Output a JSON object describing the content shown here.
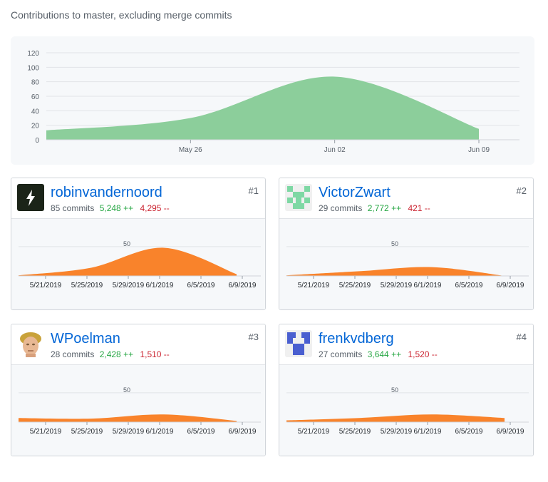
{
  "subtitle": "Contributions to master, excluding merge commits",
  "colors": {
    "main_area": "#8cce9b",
    "user_area": "#f9832b",
    "link": "#0366d6",
    "additions": "#28a745",
    "deletions": "#cb2431"
  },
  "chart_data": [
    {
      "type": "area",
      "title": "",
      "xlabel": "",
      "ylabel": "",
      "ylim": [
        0,
        120
      ],
      "y_ticks": [
        "0",
        "20",
        "40",
        "60",
        "80",
        "100",
        "120"
      ],
      "x_tick_labels": [
        "May 26",
        "Jun 02",
        "Jun 09"
      ],
      "grid": true,
      "series": [
        {
          "x": [
            "2019-05-19",
            "2019-05-26",
            "2019-06-02",
            "2019-06-09"
          ],
          "values": [
            13,
            30,
            87,
            15
          ]
        }
      ]
    },
    {
      "type": "area",
      "title": "",
      "ylim": [
        0,
        85
      ],
      "y_ticks": [
        "50"
      ],
      "x_tick_labels": [
        "5/21/2019",
        "5/25/2019",
        "5/29/2019",
        "6/1/2019",
        "6/5/2019",
        "6/9/2019"
      ],
      "series": [
        {
          "x": [
            "2019-05-19",
            "2019-05-26",
            "2019-06-02",
            "2019-06-09"
          ],
          "values": [
            1,
            14,
            48,
            3
          ]
        }
      ]
    },
    {
      "type": "area",
      "title": "",
      "ylim": [
        0,
        85
      ],
      "y_ticks": [
        "50"
      ],
      "x_tick_labels": [
        "5/21/2019",
        "5/25/2019",
        "5/29/2019",
        "6/1/2019",
        "6/5/2019",
        "6/9/2019"
      ],
      "series": [
        {
          "x": [
            "2019-05-19",
            "2019-05-26",
            "2019-06-02",
            "2019-06-09"
          ],
          "values": [
            1,
            8,
            15,
            0
          ]
        }
      ]
    },
    {
      "type": "area",
      "title": "",
      "ylim": [
        0,
        85
      ],
      "y_ticks": [
        "50"
      ],
      "x_tick_labels": [
        "5/21/2019",
        "5/25/2019",
        "5/29/2019",
        "6/1/2019",
        "6/5/2019",
        "6/9/2019"
      ],
      "series": [
        {
          "x": [
            "2019-05-19",
            "2019-05-26",
            "2019-06-02",
            "2019-06-09"
          ],
          "values": [
            7,
            6,
            13,
            2
          ]
        }
      ]
    },
    {
      "type": "area",
      "title": "",
      "ylim": [
        0,
        85
      ],
      "y_ticks": [
        "50"
      ],
      "x_tick_labels": [
        "5/21/2019",
        "5/25/2019",
        "5/29/2019",
        "6/1/2019",
        "6/5/2019",
        "6/9/2019"
      ],
      "series": [
        {
          "x": [
            "2019-05-19",
            "2019-05-26",
            "2019-06-02",
            "2019-06-09"
          ],
          "values": [
            3,
            7,
            13,
            7
          ]
        }
      ]
    }
  ],
  "contributors": [
    {
      "name": "robinvandernoord",
      "rank": "#1",
      "commits": "85 commits",
      "additions": "5,248 ++",
      "deletions": "4,295 --",
      "avatar": "lightning-avatar"
    },
    {
      "name": "VictorZwart",
      "rank": "#2",
      "commits": "29 commits",
      "additions": "2,772 ++",
      "deletions": "421 --",
      "avatar": "green-identicon-avatar"
    },
    {
      "name": "WPoelman",
      "rank": "#3",
      "commits": "28 commits",
      "additions": "2,428 ++",
      "deletions": "1,510 --",
      "avatar": "statue-avatar"
    },
    {
      "name": "frenkvdberg",
      "rank": "#4",
      "commits": "27 commits",
      "additions": "3,644 ++",
      "deletions": "1,520 --",
      "avatar": "blue-identicon-avatar"
    }
  ]
}
